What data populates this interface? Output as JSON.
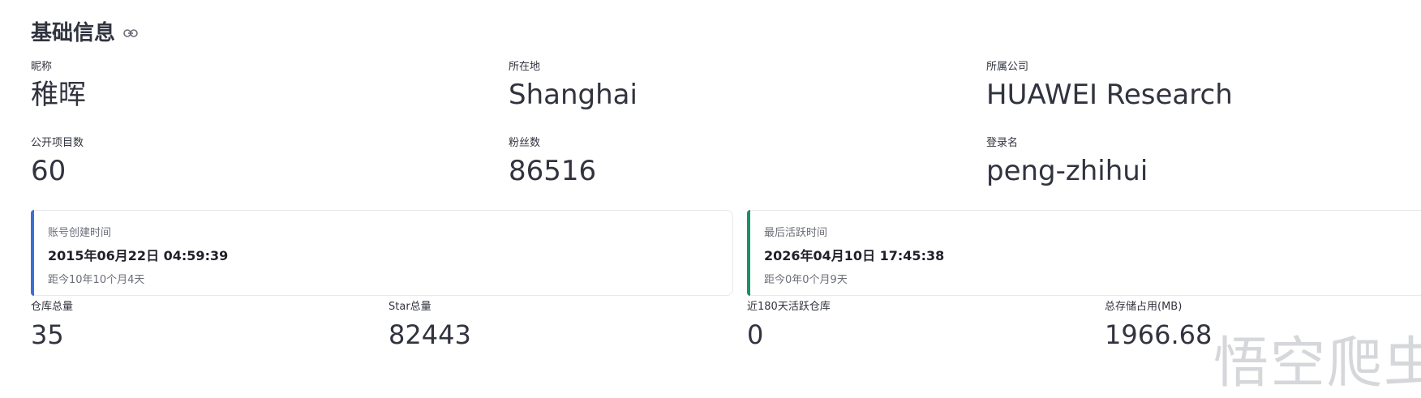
{
  "section": {
    "title": "基础信息",
    "link_icon": "link-icon"
  },
  "profile": {
    "nickname_label": "昵称",
    "nickname": "稚晖",
    "location_label": "所在地",
    "location": "Shanghai",
    "company_label": "所属公司",
    "company": "HUAWEI Research",
    "public_repos_label": "公开项目数",
    "public_repos": "60",
    "followers_label": "粉丝数",
    "followers": "86516",
    "login_label": "登录名",
    "login": "peng-zhihui"
  },
  "cards": {
    "created": {
      "label": "账号创建时间",
      "value": "2015年06月22日 04:59:39",
      "sub": "距今10年10个月4天",
      "accent": "#3a6fd8"
    },
    "last_active": {
      "label": "最后活跃时间",
      "value": "2026年04月10日 17:45:38",
      "sub": "距今0年0个月9天",
      "accent": "#1a8f6a"
    }
  },
  "stats": {
    "repos_label": "仓库总量",
    "repos": "35",
    "stars_label": "Star总量",
    "stars": "82443",
    "active_repos_label": "近180天活跃仓库",
    "active_repos": "0",
    "storage_label": "总存储占用(MB)",
    "storage": "1966.68"
  },
  "watermark": "悟空爬虫"
}
